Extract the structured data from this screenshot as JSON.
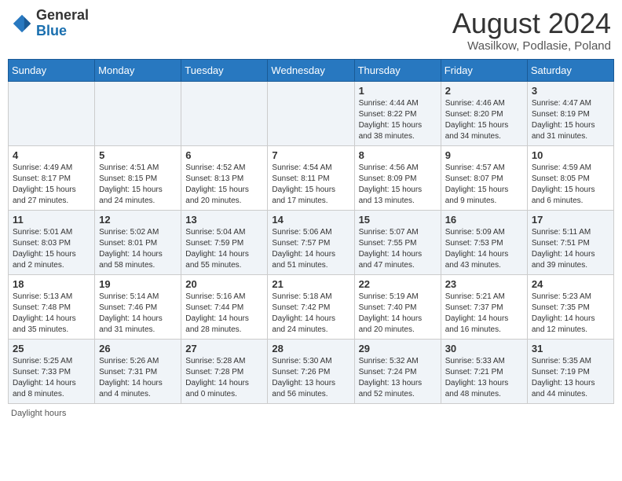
{
  "header": {
    "logo_general": "General",
    "logo_blue": "Blue",
    "month_year": "August 2024",
    "location": "Wasilkow, Podlasie, Poland"
  },
  "days_of_week": [
    "Sunday",
    "Monday",
    "Tuesday",
    "Wednesday",
    "Thursday",
    "Friday",
    "Saturday"
  ],
  "footer": {
    "daylight_label": "Daylight hours"
  },
  "weeks": [
    {
      "days": [
        {
          "num": "",
          "info": ""
        },
        {
          "num": "",
          "info": ""
        },
        {
          "num": "",
          "info": ""
        },
        {
          "num": "",
          "info": ""
        },
        {
          "num": "1",
          "info": "Sunrise: 4:44 AM\nSunset: 8:22 PM\nDaylight: 15 hours and 38 minutes."
        },
        {
          "num": "2",
          "info": "Sunrise: 4:46 AM\nSunset: 8:20 PM\nDaylight: 15 hours and 34 minutes."
        },
        {
          "num": "3",
          "info": "Sunrise: 4:47 AM\nSunset: 8:19 PM\nDaylight: 15 hours and 31 minutes."
        }
      ]
    },
    {
      "days": [
        {
          "num": "4",
          "info": "Sunrise: 4:49 AM\nSunset: 8:17 PM\nDaylight: 15 hours and 27 minutes."
        },
        {
          "num": "5",
          "info": "Sunrise: 4:51 AM\nSunset: 8:15 PM\nDaylight: 15 hours and 24 minutes."
        },
        {
          "num": "6",
          "info": "Sunrise: 4:52 AM\nSunset: 8:13 PM\nDaylight: 15 hours and 20 minutes."
        },
        {
          "num": "7",
          "info": "Sunrise: 4:54 AM\nSunset: 8:11 PM\nDaylight: 15 hours and 17 minutes."
        },
        {
          "num": "8",
          "info": "Sunrise: 4:56 AM\nSunset: 8:09 PM\nDaylight: 15 hours and 13 minutes."
        },
        {
          "num": "9",
          "info": "Sunrise: 4:57 AM\nSunset: 8:07 PM\nDaylight: 15 hours and 9 minutes."
        },
        {
          "num": "10",
          "info": "Sunrise: 4:59 AM\nSunset: 8:05 PM\nDaylight: 15 hours and 6 minutes."
        }
      ]
    },
    {
      "days": [
        {
          "num": "11",
          "info": "Sunrise: 5:01 AM\nSunset: 8:03 PM\nDaylight: 15 hours and 2 minutes."
        },
        {
          "num": "12",
          "info": "Sunrise: 5:02 AM\nSunset: 8:01 PM\nDaylight: 14 hours and 58 minutes."
        },
        {
          "num": "13",
          "info": "Sunrise: 5:04 AM\nSunset: 7:59 PM\nDaylight: 14 hours and 55 minutes."
        },
        {
          "num": "14",
          "info": "Sunrise: 5:06 AM\nSunset: 7:57 PM\nDaylight: 14 hours and 51 minutes."
        },
        {
          "num": "15",
          "info": "Sunrise: 5:07 AM\nSunset: 7:55 PM\nDaylight: 14 hours and 47 minutes."
        },
        {
          "num": "16",
          "info": "Sunrise: 5:09 AM\nSunset: 7:53 PM\nDaylight: 14 hours and 43 minutes."
        },
        {
          "num": "17",
          "info": "Sunrise: 5:11 AM\nSunset: 7:51 PM\nDaylight: 14 hours and 39 minutes."
        }
      ]
    },
    {
      "days": [
        {
          "num": "18",
          "info": "Sunrise: 5:13 AM\nSunset: 7:48 PM\nDaylight: 14 hours and 35 minutes."
        },
        {
          "num": "19",
          "info": "Sunrise: 5:14 AM\nSunset: 7:46 PM\nDaylight: 14 hours and 31 minutes."
        },
        {
          "num": "20",
          "info": "Sunrise: 5:16 AM\nSunset: 7:44 PM\nDaylight: 14 hours and 28 minutes."
        },
        {
          "num": "21",
          "info": "Sunrise: 5:18 AM\nSunset: 7:42 PM\nDaylight: 14 hours and 24 minutes."
        },
        {
          "num": "22",
          "info": "Sunrise: 5:19 AM\nSunset: 7:40 PM\nDaylight: 14 hours and 20 minutes."
        },
        {
          "num": "23",
          "info": "Sunrise: 5:21 AM\nSunset: 7:37 PM\nDaylight: 14 hours and 16 minutes."
        },
        {
          "num": "24",
          "info": "Sunrise: 5:23 AM\nSunset: 7:35 PM\nDaylight: 14 hours and 12 minutes."
        }
      ]
    },
    {
      "days": [
        {
          "num": "25",
          "info": "Sunrise: 5:25 AM\nSunset: 7:33 PM\nDaylight: 14 hours and 8 minutes."
        },
        {
          "num": "26",
          "info": "Sunrise: 5:26 AM\nSunset: 7:31 PM\nDaylight: 14 hours and 4 minutes."
        },
        {
          "num": "27",
          "info": "Sunrise: 5:28 AM\nSunset: 7:28 PM\nDaylight: 14 hours and 0 minutes."
        },
        {
          "num": "28",
          "info": "Sunrise: 5:30 AM\nSunset: 7:26 PM\nDaylight: 13 hours and 56 minutes."
        },
        {
          "num": "29",
          "info": "Sunrise: 5:32 AM\nSunset: 7:24 PM\nDaylight: 13 hours and 52 minutes."
        },
        {
          "num": "30",
          "info": "Sunrise: 5:33 AM\nSunset: 7:21 PM\nDaylight: 13 hours and 48 minutes."
        },
        {
          "num": "31",
          "info": "Sunrise: 5:35 AM\nSunset: 7:19 PM\nDaylight: 13 hours and 44 minutes."
        }
      ]
    }
  ]
}
